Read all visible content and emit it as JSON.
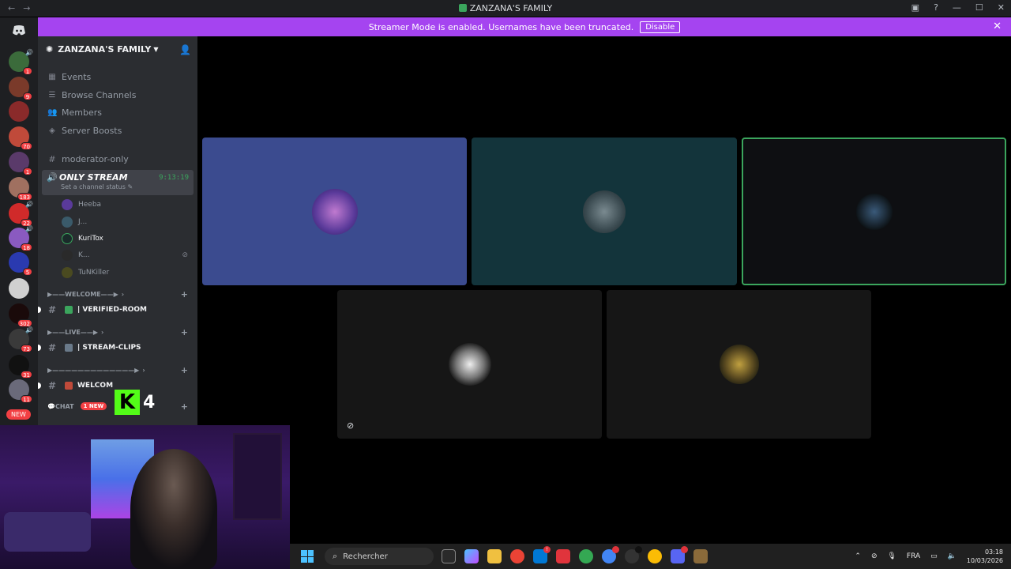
{
  "window": {
    "title": "ZANZANA'S FAMILY"
  },
  "banner": {
    "text": "Streamer Mode is enabled. Usernames have been truncated.",
    "button": "Disable"
  },
  "guild_badges": [
    "1",
    "9",
    "",
    "70",
    "1",
    "183",
    "22",
    "18",
    "5",
    "",
    "302",
    "73",
    "31",
    "11"
  ],
  "new_label": "NEW",
  "server": {
    "name": "ZANZANA'S FAMILY",
    "menu": [
      {
        "label": "Events",
        "icon": "calendar-icon"
      },
      {
        "label": "Browse Channels",
        "icon": "browse-channels-icon"
      },
      {
        "label": "Members",
        "icon": "members-icon"
      },
      {
        "label": "Server Boosts",
        "icon": "boost-icon"
      }
    ],
    "text_channel": "moderator-only",
    "voice_channel": {
      "name": "ONLY STREAM",
      "status": "Set a channel status",
      "timer": "9:13:19",
      "users": [
        "Heeba",
        "J...",
        "KuriTox",
        "K...",
        "TuNKiller"
      ]
    },
    "categories": [
      {
        "label": "▶——WELCOME——▶",
        "channel": "| VERIFIED-ROOM"
      },
      {
        "label": "▶——LIVE——▶",
        "channel": "| STREAM-CLIPS"
      },
      {
        "label": "▶—————————————▶",
        "channel": "WELCOM"
      }
    ],
    "chat_label": "CHAT",
    "new_badge": "1 NEW"
  },
  "overlay": {
    "kick_letter": "K",
    "kick_count": "4"
  },
  "taskbar": {
    "search_placeholder": "Rechercher",
    "language": "FRA",
    "time": "03:18",
    "date": "10/03/2026"
  },
  "colors": {
    "accent": "#a544f0",
    "speaking": "#3ba55d",
    "kick": "#53fc18"
  }
}
